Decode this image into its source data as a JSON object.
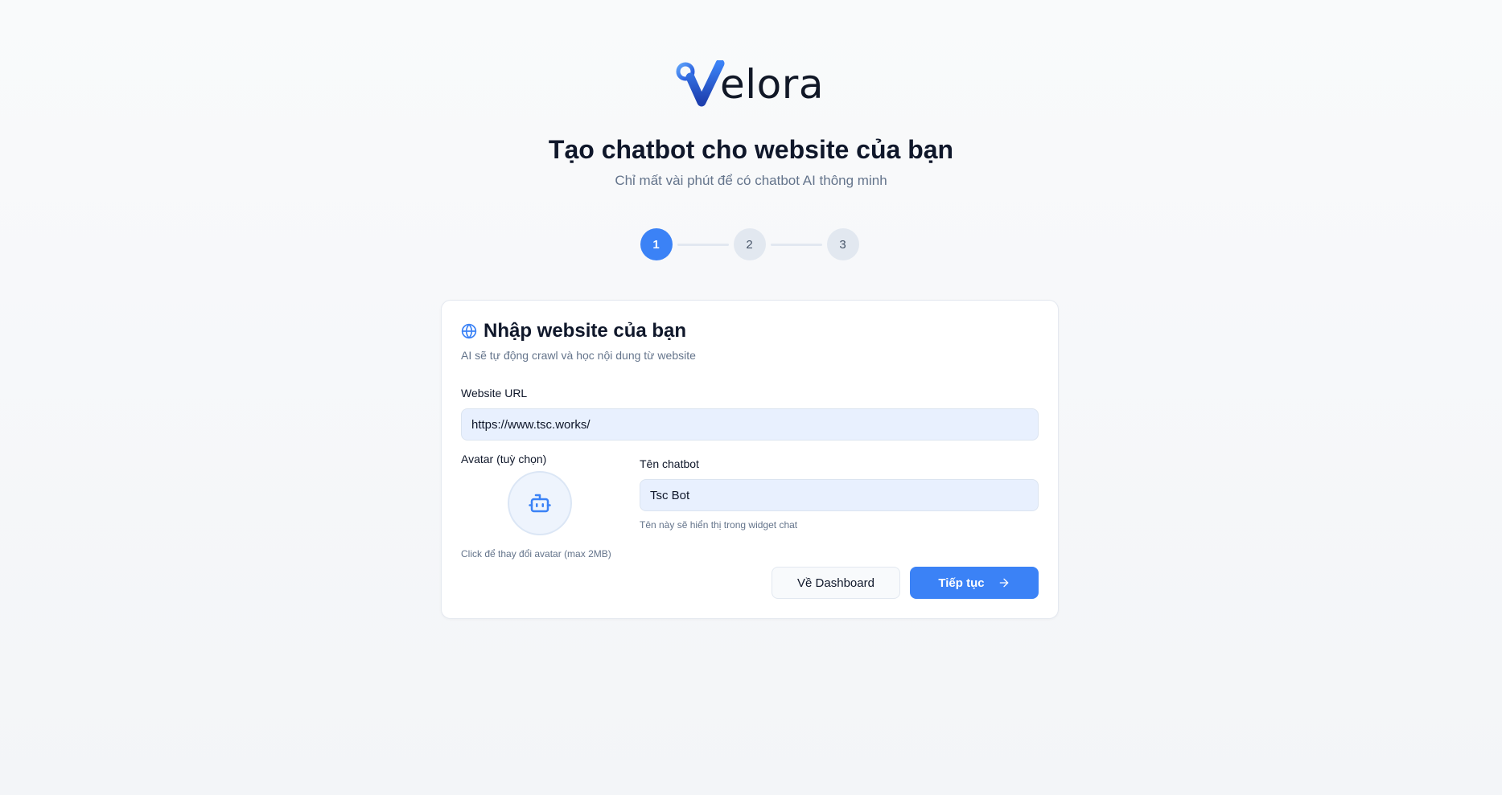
{
  "brand": {
    "logo_text": "elora",
    "accent_color": "#3b82f6"
  },
  "header": {
    "title": "Tạo chatbot cho website của bạn",
    "subtitle": "Chỉ mất vài phút để có chatbot AI thông minh"
  },
  "stepper": {
    "current_step": 1,
    "steps": [
      {
        "label": "1",
        "state": "active"
      },
      {
        "label": "2",
        "state": "inactive"
      },
      {
        "label": "3",
        "state": "inactive"
      }
    ]
  },
  "card": {
    "icon": "globe-icon",
    "title": "Nhập website của bạn",
    "subtitle": "AI sẽ tự động crawl và học nội dung từ website",
    "url_field": {
      "label": "Website URL",
      "value": "https://www.tsc.works/"
    },
    "avatar": {
      "label": "Avatar (tuỳ chọn)",
      "icon": "bot-icon",
      "help": "Click để thay đổi avatar (max 2MB)"
    },
    "name_field": {
      "label": "Tên chatbot",
      "value": "Tsc Bot",
      "help": "Tên này sẽ hiển thị trong widget chat"
    },
    "actions": {
      "back_label": "Về Dashboard",
      "next_label": "Tiếp tục",
      "next_icon": "arrow-right-icon"
    }
  }
}
